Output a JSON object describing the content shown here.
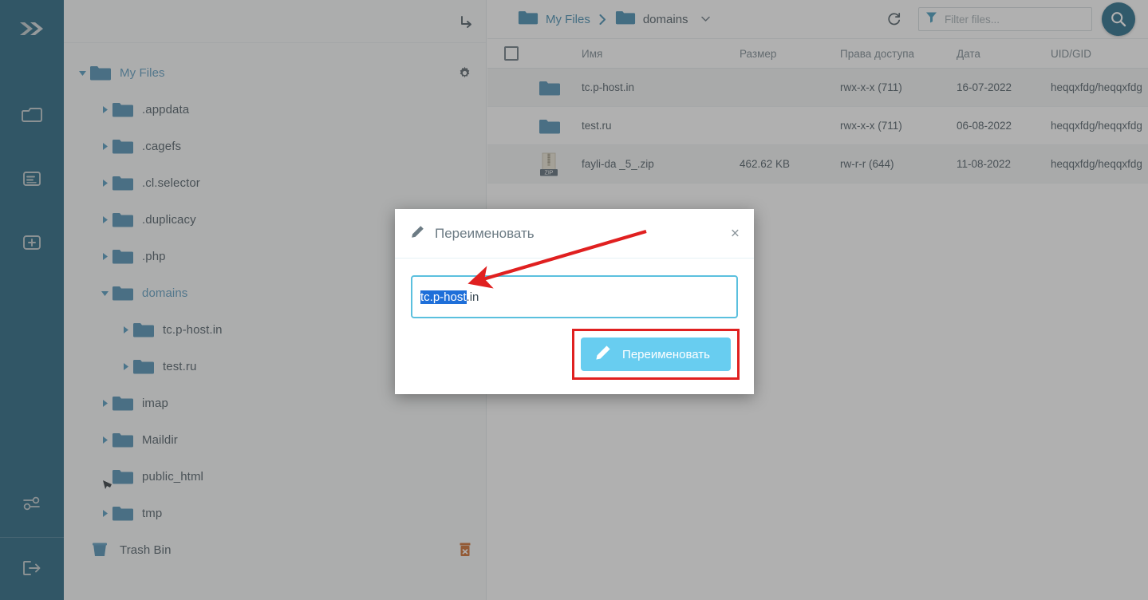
{
  "app": {
    "rail_icons": [
      {
        "name": "logo-chevrons-icon",
        "label": "Logo"
      },
      {
        "name": "folder-icon",
        "label": "File Manager"
      },
      {
        "name": "document-icon",
        "label": "Documents"
      },
      {
        "name": "add-plus-icon",
        "label": "Create"
      },
      {
        "name": "settings-sliders-icon",
        "label": "Settings"
      },
      {
        "name": "logout-icon",
        "label": "Log out"
      }
    ]
  },
  "tree": {
    "top_icon": "redirect-arrow-icon",
    "root": {
      "label": "My Files",
      "expanded": true,
      "gear": "gear-icon"
    },
    "items": [
      {
        "label": ".appdata",
        "indent": 1,
        "caret": "collapsed"
      },
      {
        "label": ".cagefs",
        "indent": 1,
        "caret": "collapsed"
      },
      {
        "label": ".cl.selector",
        "indent": 1,
        "caret": "collapsed"
      },
      {
        "label": ".duplicacy",
        "indent": 1,
        "caret": "collapsed"
      },
      {
        "label": ".php",
        "indent": 1,
        "caret": "collapsed"
      },
      {
        "label": "domains",
        "indent": 1,
        "caret": "expanded",
        "accent": true
      },
      {
        "label": "tc.p-host.in",
        "indent": 2,
        "caret": "collapsed"
      },
      {
        "label": "test.ru",
        "indent": 2,
        "caret": "collapsed"
      },
      {
        "label": "imap",
        "indent": 1,
        "caret": "collapsed"
      },
      {
        "label": "Maildir",
        "indent": 1,
        "caret": "collapsed"
      },
      {
        "label": "public_html",
        "indent": 1,
        "caret": "none",
        "cursor": true
      },
      {
        "label": "tmp",
        "indent": 1,
        "caret": "collapsed"
      }
    ],
    "trash": {
      "label": "Trash Bin",
      "icon": "trash-bin-icon",
      "action_icon": "delete-trash-icon"
    }
  },
  "toolbar": {
    "breadcrumb": [
      {
        "label": "My Files",
        "icon": "folder-icon"
      },
      {
        "label": "domains",
        "icon": "folder-icon",
        "chevron": "chevron-down-icon"
      }
    ],
    "separator_icon": "chevron-right-icon",
    "refresh_icon": "refresh-icon",
    "filter_icon": "filter-funnel-icon",
    "filter_placeholder": "Filter files...",
    "filter_value": "",
    "search_icon": "search-icon"
  },
  "table": {
    "columns": [
      "",
      "Имя",
      "Размер",
      "Права доступа",
      "Дата",
      "UID/GID"
    ],
    "rows": [
      {
        "icon": "folder-icon",
        "name": "tc.p-host.in",
        "size": "",
        "perm": "rwx-x-x (711)",
        "date": "16-07-2022",
        "uid": "heqqxfdg/heqqxfdg",
        "alt": true
      },
      {
        "icon": "folder-icon",
        "name": "test.ru",
        "size": "",
        "perm": "rwx-x-x (711)",
        "date": "06-08-2022",
        "uid": "heqqxfdg/heqqxfdg",
        "alt": false
      },
      {
        "icon": "zip-file-icon",
        "name": "fayli-da _5_.zip",
        "size": "462.62 KB",
        "perm": "rw-r-r (644)",
        "date": "11-08-2022",
        "uid": "heqqxfdg/heqqxfdg",
        "alt": true
      }
    ]
  },
  "modal": {
    "title": "Переименовать",
    "title_icon": "pencil-icon",
    "close_label": "×",
    "input_selected": "tc.p-host",
    "input_rest": ".in",
    "button_label": "Переименовать",
    "button_icon": "pencil-icon"
  },
  "annotation": {
    "arrow_color": "#e02020",
    "highlight_color": "#e02020"
  },
  "colors": {
    "rail_bg": "#0d5472",
    "accent": "#2e7fa8",
    "folder_blue": "#3d83ab",
    "button_blue": "#68cdf0",
    "selection_blue": "#1e6fd9"
  }
}
